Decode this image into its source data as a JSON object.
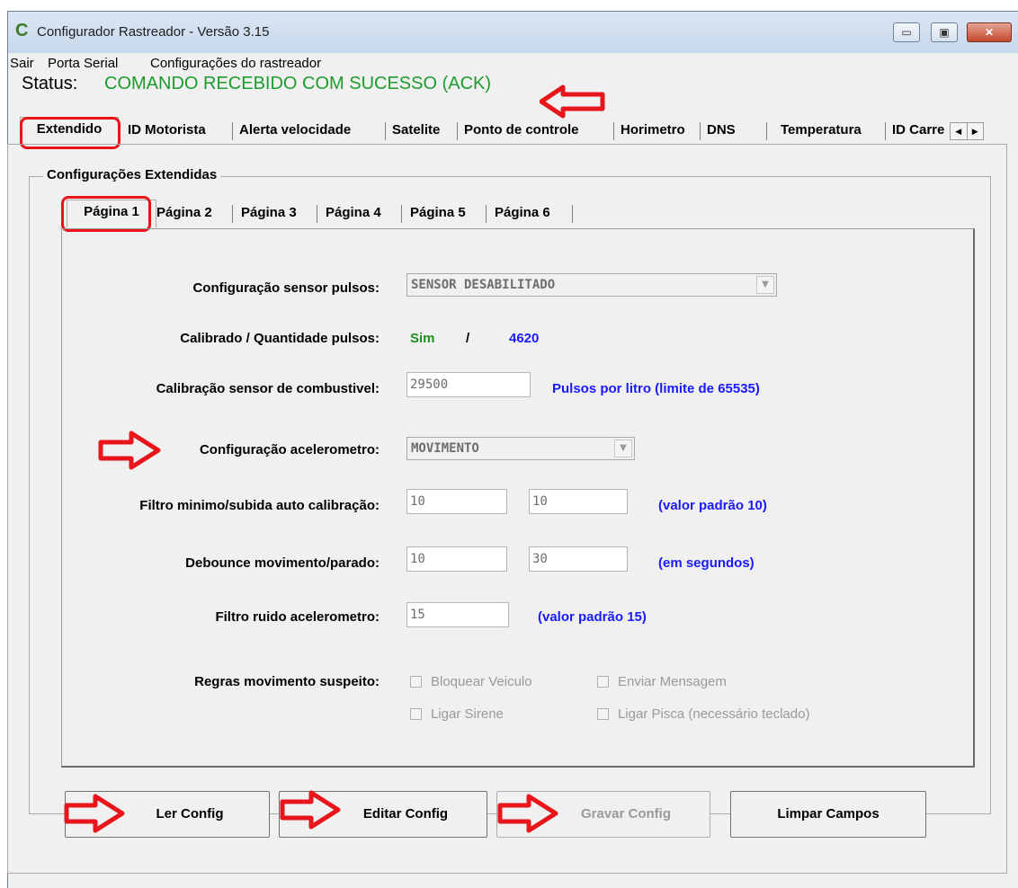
{
  "window": {
    "title": "Configurador Rastreador - Versão 3.15",
    "buttons": {
      "minimize": "▭",
      "maximize": "▣",
      "close": "✕"
    }
  },
  "menu": {
    "items": [
      "Sair",
      "Porta Serial",
      "Configurações do rastreador"
    ]
  },
  "status": {
    "label": "Status:",
    "value": "COMANDO RECEBIDO COM SUCESSO (ACK)",
    "color": "#1c9c2c"
  },
  "tabs": {
    "items": [
      "Extendido",
      "ID Motorista",
      "Alerta velocidade",
      "Satelite",
      "Ponto de controle",
      "Horimetro",
      "DNS",
      "Temperatura",
      "ID Carre"
    ],
    "selected": "Extendido",
    "scroll_left": "◀",
    "scroll_right": "▶"
  },
  "group": {
    "title": "Configurações Extendidas"
  },
  "subtabs": {
    "items": [
      "Página 1",
      "Página 2",
      "Página 3",
      "Página 4",
      "Página 5",
      "Página 6"
    ],
    "selected": "Página 1"
  },
  "form": {
    "sensor_pulsos": {
      "label": "Configuração sensor pulsos:",
      "value": "SENSOR DESABILITADO"
    },
    "calibrado": {
      "label": "Calibrado / Quantidade pulsos:",
      "status": "Sim",
      "sep": "/",
      "count": "4620"
    },
    "calibracao": {
      "label": "Calibração sensor de combustivel:",
      "value": "29500",
      "note": "Pulsos por litro (limite de 65535)"
    },
    "acelerometro": {
      "label": "Configuração acelerometro:",
      "value": "MOVIMENTO"
    },
    "filtro_minimo": {
      "label": "Filtro minimo/subida auto calibração:",
      "value1": "10",
      "value2": "10",
      "note": "(valor padrão 10)"
    },
    "debounce": {
      "label": "Debounce movimento/parado:",
      "value1": "10",
      "value2": "30",
      "note": "(em segundos)"
    },
    "filtro_ruido": {
      "label": "Filtro ruido acelerometro:",
      "value": "15",
      "note": "(valor padrão 15)"
    },
    "regras": {
      "label": "Regras movimento suspeito:",
      "checks": [
        "Bloquear Veiculo",
        "Enviar Mensagem",
        "Ligar Sirene",
        "Ligar Pisca (necessário teclado)"
      ]
    }
  },
  "buttons": {
    "ler": "Ler Config",
    "editar": "Editar Config",
    "gravar": "Gravar Config",
    "limpar": "Limpar Campos"
  },
  "colors": {
    "annotation": "#e8151b",
    "note_blue": "#1a1aff",
    "status_green": "#1c9c2c"
  }
}
